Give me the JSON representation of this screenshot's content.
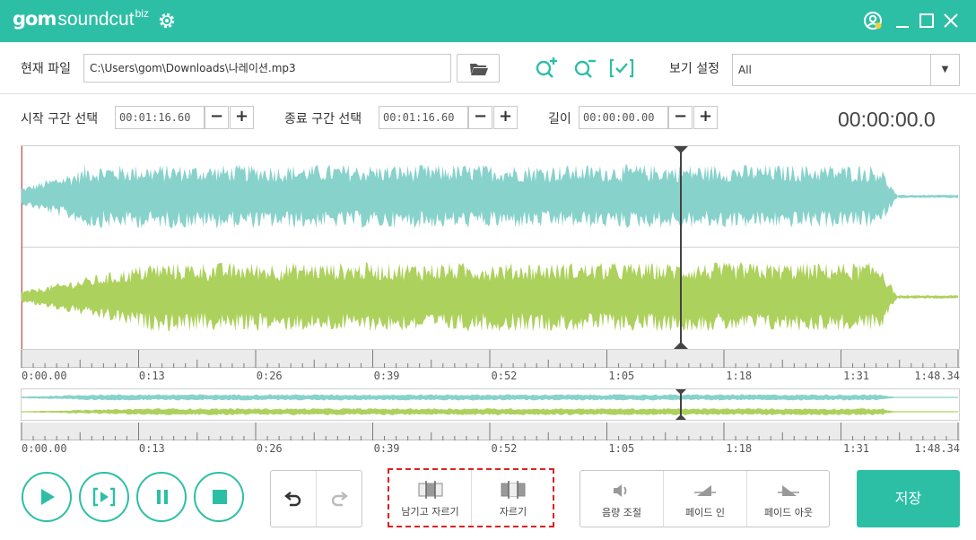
{
  "app": {
    "logo_gom": "gom",
    "logo_soundcut": "soundcut",
    "logo_biz": "biz"
  },
  "toolbar": {
    "current_file_label": "현재 파일",
    "current_file_value": "C:\\Users\\gom\\Downloads\\나레이션.mp3",
    "view_setting_label": "보기 설정",
    "view_setting_value": "All"
  },
  "range": {
    "start_label": "시작 구간 선택",
    "start_value": "00:01:16.60",
    "end_label": "종료 구간 선택",
    "end_value": "00:01:16.60",
    "length_label": "길이",
    "length_value": "00:00:00.00",
    "minus": "−",
    "plus": "+"
  },
  "clock": "00:00:00.0",
  "timeline": {
    "labels": [
      "0:00.00",
      "0:13",
      "0:26",
      "0:39",
      "0:52",
      "1:05",
      "1:18",
      "1:31",
      "1:48.34"
    ],
    "playhead_fraction": 0.703
  },
  "edit": {
    "keep_cut": "남기고 자르기",
    "cut": "자르기",
    "volume": "음량 조절",
    "fade_in": "페이드 인",
    "fade_out": "페이드 아웃",
    "save": "저장"
  },
  "colors": {
    "accent": "#2dbfa6",
    "wave_top": "#88d2cc",
    "wave_bottom": "#add15d",
    "highlight_border": "#e02020"
  }
}
